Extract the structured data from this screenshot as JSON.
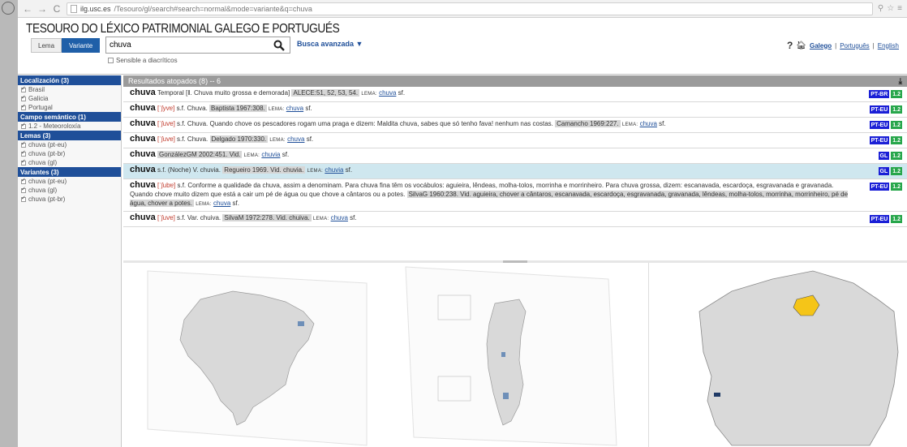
{
  "browser": {
    "url_host": "ilg.usc.es",
    "url_rest": "/Tesouro/gl/search#search=normal&mode=variante&q=chuva"
  },
  "header": {
    "title": "TESOURO DO LÉXICO PATRIMONIAL GALEGO E PORTUGUÉS",
    "tabs": [
      "Lema",
      "Variante"
    ],
    "active_tab": "Variante",
    "search_value": "chuva",
    "advanced_search": "Busca avanzada ▼",
    "diacritics_label": "Sensible a diacríticos",
    "help": "?",
    "languages": [
      "Galego",
      "Português",
      "English"
    ]
  },
  "sidebar": {
    "facets": [
      {
        "title": "Localización (3)",
        "items": [
          "Brasil",
          "Galicia",
          "Portugal"
        ]
      },
      {
        "title": "Campo semántico (1)",
        "items": [
          "1.2 - Meteoroloxía"
        ]
      },
      {
        "title": "Lemas (3)",
        "items": [
          "chuva (pt-eu)",
          "chuva (pt-br)",
          "chuva (gl)"
        ]
      },
      {
        "title": "Variantes (3)",
        "items": [
          "chuva (pt-eu)",
          "chuva (gl)",
          "chuva (pt-br)"
        ]
      }
    ]
  },
  "results": {
    "header": "Resultados atopados (8) -- 6",
    "rows": [
      {
        "word": "chuva",
        "pron": "",
        "text": " Temporal [ǁ. Chuva muito grossa e demorada] ",
        "cite": "ALECE:51, 52, 53, 54.",
        "lema_label": "LEMA:",
        "lema": "chuva",
        "tail": " sf.",
        "badges": [
          "PT-BR",
          "1.2"
        ]
      },
      {
        "word": "chuva",
        "pron": " [ˈʃyvɐ]",
        "text": " s.f. Chuva. ",
        "cite": "Baptista 1967:308.",
        "lema_label": "LEMA:",
        "lema": "chuva",
        "tail": " sf.",
        "badges": [
          "PT-EU",
          "1.2"
        ]
      },
      {
        "word": "chuva",
        "pron": " [ˈʃuvɐ]",
        "text": " s.f. Chuva. Quando chove os pescadores rogam uma praga e dizem: Maldita chuva, sabes que só tenho fava! nenhum nas costas. ",
        "cite": "Camancho 1969:227.",
        "lema_label": "LEMA:",
        "lema": "chuva",
        "tail": " sf.",
        "badges": [
          "PT-EU",
          "1.2"
        ]
      },
      {
        "word": "chuva",
        "pron": " [ˈʃuvɐ]",
        "text": " s.f. Chuva. ",
        "cite": "Delgado 1970:330.",
        "lema_label": "LEMA:",
        "lema": "chuva",
        "tail": " sf.",
        "badges": [
          "PT-EU",
          "1.2"
        ]
      },
      {
        "word": "chuva",
        "pron": "",
        "text": " ",
        "cite": "GonzálezGM 2002:451. Vid.",
        "lema_label": "LEMA:",
        "lema": "chuvia",
        "tail": " sf.",
        "badges": [
          "GL",
          "1.2"
        ]
      },
      {
        "word": "chuva",
        "pron": "",
        "text": " s.f. (Noche) V. chuvia. ",
        "cite": "Regueiro 1969. Vid. chuvia.",
        "lema_label": "LEMA:",
        "lema": "chuvia",
        "tail": " sf.",
        "badges": [
          "GL",
          "1.2"
        ],
        "highlight": true
      },
      {
        "word": "chuva",
        "pron": " [ˈʃubɐ]",
        "text": " s.f. Conforme a qualidade da chuva, assim a denominam. Para chuva fina têm os vocábulos: aguieira, lêndeas, molha-tolos, morrinha e morrinheiro. Para chuva grossa, dizem: escanavada, escardoça, esgravanada e gravanada. Quando chove muito dizem que está a cair um pé de água ou que chove a cântaros ou a potes. ",
        "cite": "SilvaG 1960:238. Vid. aguieira, chover a cântaros, escanavada, escardoça, esgravanada, gravanada, lêndeas, molha-tolos, morrinha, morrinheiro, pé de água, chover a potes.",
        "lema_label": "LEMA:",
        "lema": "chuva",
        "tail": " sf.",
        "badges": [
          "PT-EU",
          "1.2"
        ]
      },
      {
        "word": "chuva",
        "pron": " [ˈʃuvɐ]",
        "text": " s.f. Var. chuiva. ",
        "cite": "SilvaM 1972:278. Vid. chuiva.",
        "lema_label": "LEMA:",
        "lema": "chuva",
        "tail": " sf.",
        "badges": [
          "PT-EU",
          "1.2"
        ]
      }
    ]
  },
  "colors": {
    "brand_blue": "#1f4f99",
    "badge_country": "#1a1fd6",
    "badge_field": "#27a64b",
    "highlight_row": "#cfe7ef",
    "map_region": "#d9d9d9",
    "map_highlight_gl": "#f5c518",
    "map_highlight_pt": "#6e8fb8"
  },
  "icons": {
    "search": "magnifier-icon",
    "download": "download-icon",
    "home": "home-icon",
    "help": "help-icon"
  }
}
